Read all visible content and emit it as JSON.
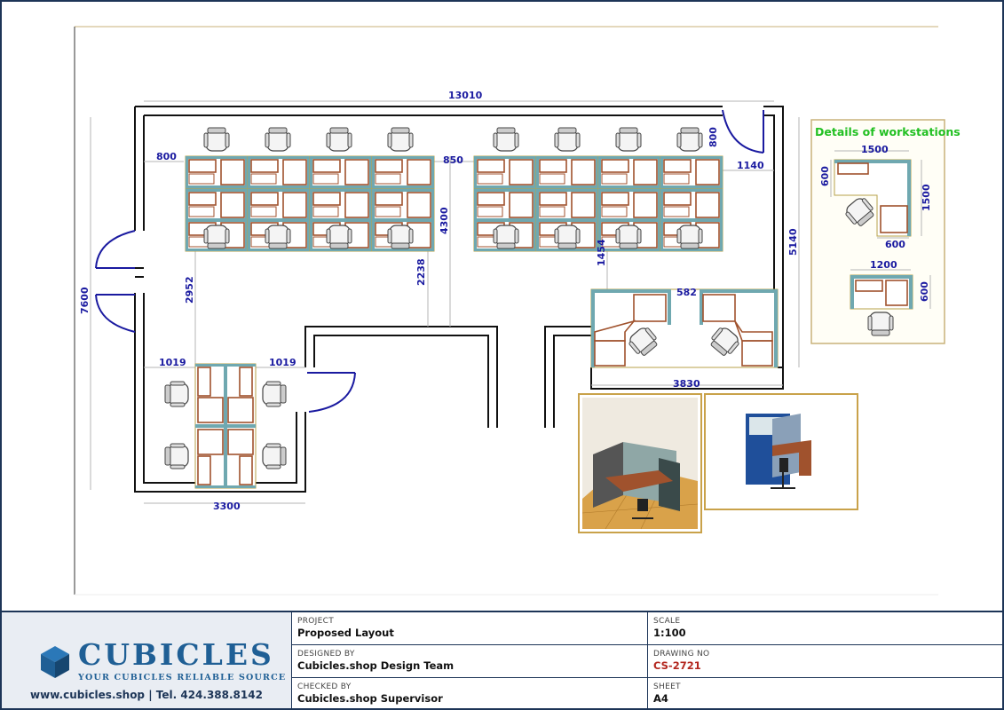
{
  "dimensions": {
    "overall_width": "13010",
    "overall_height": "7600",
    "left_margin": "800",
    "top_right_gap": "800",
    "aisle_gap": "850",
    "right_clear": "1140",
    "cluster_depth": "4300",
    "right_height": "5140",
    "left_aisle": "2952",
    "center_aisle": "2238",
    "right_aisle": "1454",
    "pod_gap": "582",
    "pod_width": "3830",
    "lower_left_gap": "1019",
    "lower_right_gap": "1019",
    "lower_room_width": "3300"
  },
  "details": {
    "title": "Details of workstations",
    "l_width": "1500",
    "l_depth_left": "600",
    "l_depth_right": "1500",
    "l_return": "600",
    "straight_width": "1200",
    "straight_depth": "600"
  },
  "brand": {
    "name": "CUBICLES",
    "tagline": "YOUR CUBICLES RELIABLE SOURCE",
    "contact": "www.cubicles.shop   |   Tel. 424.388.8142"
  },
  "title_block": {
    "project_label": "PROJECT",
    "project_value": "Proposed Layout",
    "scale_label": "SCALE",
    "scale_value": "1:100",
    "designed_label": "DESIGNED BY",
    "designed_value": "Cubicles.shop Design Team",
    "drawing_label": "DRAWING NO",
    "drawing_value": "CS-2721",
    "checked_label": "CHECKED BY",
    "checked_value": "Cubicles.shop Supervisor",
    "sheet_label": "SHEET",
    "sheet_value": "A4"
  },
  "colors": {
    "dimension_text": "#1a1aa0",
    "panel": "#6fa8b0",
    "desk": "#a0522d",
    "frame": "#1d3557",
    "details_title": "#22c022",
    "drawing_no": "#b3261e"
  }
}
